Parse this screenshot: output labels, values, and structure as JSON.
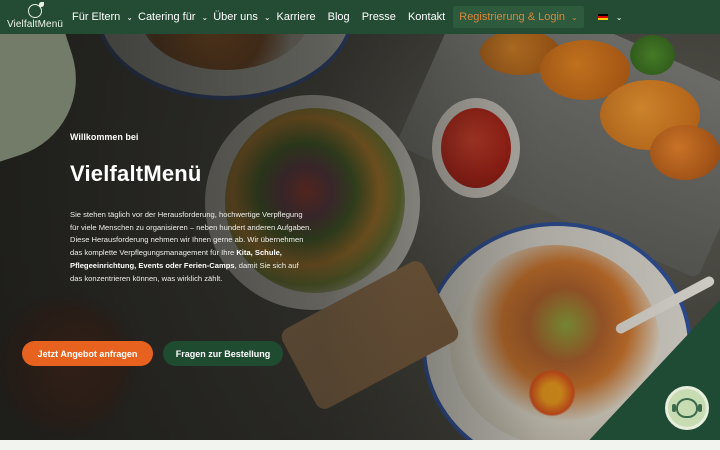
{
  "header": {
    "logo_text": "VielfaltMenü",
    "nav": [
      {
        "label": "Für Eltern",
        "has_dropdown": true
      },
      {
        "label": "Catering für",
        "has_dropdown": true
      },
      {
        "label": "Über uns",
        "has_dropdown": true
      },
      {
        "label": "Karriere",
        "has_dropdown": false
      },
      {
        "label": "Blog",
        "has_dropdown": false
      },
      {
        "label": "Presse",
        "has_dropdown": false
      },
      {
        "label": "Kontakt",
        "has_dropdown": false
      }
    ],
    "register_login": "Registrierung & Login",
    "language": "de"
  },
  "hero": {
    "eyebrow": "Willkommen bei",
    "title": "VielfaltMenü",
    "description_parts": [
      {
        "text": "Sie stehen täglich vor der Herausforderung, hochwertige Verpflegung für viele Menschen zu organisieren – neben hundert anderen Aufgaben. Diese Herausforderung nehmen wir Ihnen gerne ab. Wir übernehmen das komplette Verpflegungsmanagement für Ihre ",
        "bold": false
      },
      {
        "text": "Kita, Schule, Pflegeeinrichtung, Events oder Ferien-Camps",
        "bold": true
      },
      {
        "text": ", damit Sie sich auf das konzentrieren können, was wirklich zählt.",
        "bold": false
      }
    ],
    "cta_primary": "Jetzt Angebot anfragen",
    "cta_secondary": "Fragen zur Bestellung"
  },
  "colors": {
    "header_bg": "#244c34",
    "accent_orange": "#e8621f",
    "register_text": "#d9863d",
    "dark_green_button": "#1f4b31"
  },
  "icons": {
    "logo": "leaf-circle-icon",
    "dropdown": "chevron-down-icon",
    "flag": "german-flag-icon",
    "chat": "support-agent-icon"
  }
}
